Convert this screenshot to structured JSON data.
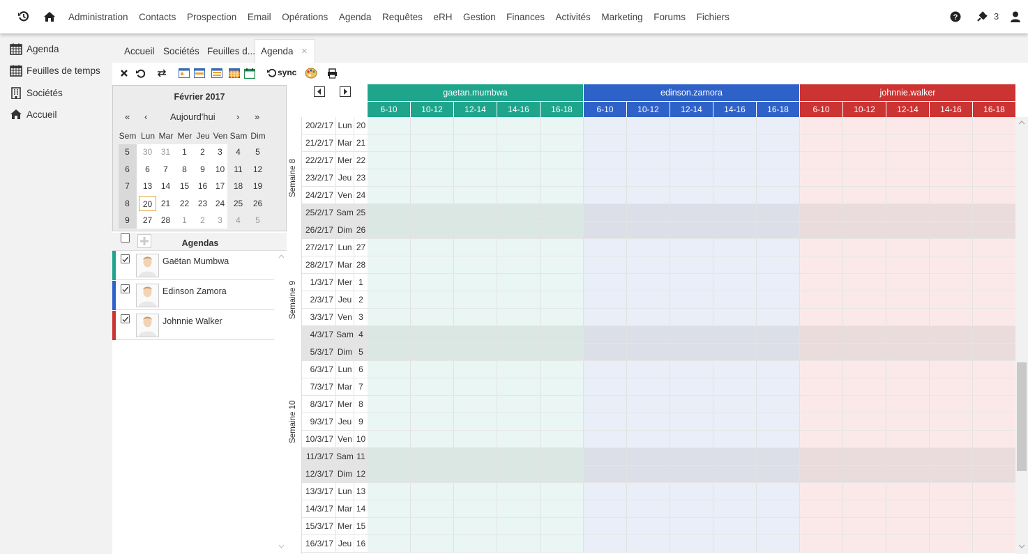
{
  "topbar": {
    "menu": [
      "Administration",
      "Contacts",
      "Prospection",
      "Email",
      "Opérations",
      "Agenda",
      "Requêtes",
      "eRH",
      "Gestion",
      "Finances",
      "Activités",
      "Marketing",
      "Forums",
      "Fichiers"
    ],
    "plugin_count": "3"
  },
  "sidebar": {
    "items": [
      {
        "label": "Agenda",
        "icon": "calendar-icon"
      },
      {
        "label": "Feuilles de temps",
        "icon": "calendar-icon"
      },
      {
        "label": "Sociétés",
        "icon": "building-icon"
      },
      {
        "label": "Accueil",
        "icon": "home-icon"
      }
    ]
  },
  "tabs": [
    {
      "label": "Accueil"
    },
    {
      "label": "Sociétés"
    },
    {
      "label": "Feuilles d..."
    },
    {
      "label": "Agenda",
      "active": true
    }
  ],
  "tab_close": "×",
  "toolbar": {
    "sync_label": "sync"
  },
  "calendar": {
    "month_title": "Février 2017",
    "nav": {
      "first": "«",
      "prev": "‹",
      "today": "Aujourd'hui",
      "next": "›",
      "last": "»"
    },
    "headers": [
      "Sem",
      "Lun",
      "Mar",
      "Mer",
      "Jeu",
      "Ven",
      "Sam",
      "Dim"
    ],
    "weeks": [
      {
        "week": "5",
        "days": [
          "30",
          "31",
          "1",
          "2",
          "3",
          "4",
          "5"
        ],
        "other": [
          true,
          true,
          false,
          false,
          false,
          false,
          false
        ]
      },
      {
        "week": "6",
        "days": [
          "6",
          "7",
          "8",
          "9",
          "10",
          "11",
          "12"
        ],
        "other": [
          false,
          false,
          false,
          false,
          false,
          false,
          false
        ]
      },
      {
        "week": "7",
        "days": [
          "13",
          "14",
          "15",
          "16",
          "17",
          "18",
          "19"
        ],
        "other": [
          false,
          false,
          false,
          false,
          false,
          false,
          false
        ]
      },
      {
        "week": "8",
        "days": [
          "20",
          "21",
          "22",
          "23",
          "24",
          "25",
          "26"
        ],
        "other": [
          false,
          false,
          false,
          false,
          false,
          false,
          false
        ]
      },
      {
        "week": "9",
        "days": [
          "27",
          "28",
          "1",
          "2",
          "3",
          "4",
          "5"
        ],
        "other": [
          false,
          false,
          true,
          true,
          true,
          true,
          true
        ]
      }
    ],
    "today": "20"
  },
  "agendas": {
    "header": "Agendas",
    "people": [
      {
        "name": "Gaëtan Mumbwa",
        "color": "#1fa58c",
        "checked": true
      },
      {
        "name": "Edinson Zamora",
        "color": "#2f62c8",
        "checked": true
      },
      {
        "name": "Johnnie Walker",
        "color": "#cc3333",
        "checked": true
      }
    ]
  },
  "grid": {
    "users": [
      {
        "login": "gaetan.mumbwa",
        "color": "#1fa58c",
        "bg": "#e9f6f3",
        "bg_we": "#dbe7e2"
      },
      {
        "login": "edinson.zamora",
        "color": "#2f62c8",
        "bg": "#e9eef8",
        "bg_we": "#dcdfe8"
      },
      {
        "login": "johnnie.walker",
        "color": "#cc3333",
        "bg": "#fbe9e9",
        "bg_we": "#eadcdc"
      }
    ],
    "slots": [
      "6-10",
      "10-12",
      "12-14",
      "14-16",
      "16-18"
    ],
    "weeks": [
      {
        "label": "Semaine 8",
        "rows": 7
      },
      {
        "label": "Semaine 9",
        "rows": 7
      },
      {
        "label": "Semaine 10",
        "rows": 7
      }
    ],
    "rows": [
      {
        "date": "20/2/17",
        "dow": "Lun",
        "day": "20"
      },
      {
        "date": "21/2/17",
        "dow": "Mar",
        "day": "21"
      },
      {
        "date": "22/2/17",
        "dow": "Mer",
        "day": "22"
      },
      {
        "date": "23/2/17",
        "dow": "Jeu",
        "day": "23"
      },
      {
        "date": "24/2/17",
        "dow": "Ven",
        "day": "24"
      },
      {
        "date": "25/2/17",
        "dow": "Sam",
        "day": "25",
        "weekend": true
      },
      {
        "date": "26/2/17",
        "dow": "Dim",
        "day": "26",
        "weekend": true
      },
      {
        "date": "27/2/17",
        "dow": "Lun",
        "day": "27"
      },
      {
        "date": "28/2/17",
        "dow": "Mar",
        "day": "28"
      },
      {
        "date": "1/3/17",
        "dow": "Mer",
        "day": "1"
      },
      {
        "date": "2/3/17",
        "dow": "Jeu",
        "day": "2"
      },
      {
        "date": "3/3/17",
        "dow": "Ven",
        "day": "3"
      },
      {
        "date": "4/3/17",
        "dow": "Sam",
        "day": "4",
        "weekend": true
      },
      {
        "date": "5/3/17",
        "dow": "Dim",
        "day": "5",
        "weekend": true
      },
      {
        "date": "6/3/17",
        "dow": "Lun",
        "day": "6"
      },
      {
        "date": "7/3/17",
        "dow": "Mar",
        "day": "7"
      },
      {
        "date": "8/3/17",
        "dow": "Mer",
        "day": "8"
      },
      {
        "date": "9/3/17",
        "dow": "Jeu",
        "day": "9"
      },
      {
        "date": "10/3/17",
        "dow": "Ven",
        "day": "10"
      },
      {
        "date": "11/3/17",
        "dow": "Sam",
        "day": "11",
        "weekend": true
      },
      {
        "date": "12/3/17",
        "dow": "Dim",
        "day": "12",
        "weekend": true
      },
      {
        "date": "13/3/17",
        "dow": "Lun",
        "day": "13"
      },
      {
        "date": "14/3/17",
        "dow": "Mar",
        "day": "14"
      },
      {
        "date": "15/3/17",
        "dow": "Mer",
        "day": "15"
      },
      {
        "date": "16/3/17",
        "dow": "Jeu",
        "day": "16"
      }
    ]
  }
}
